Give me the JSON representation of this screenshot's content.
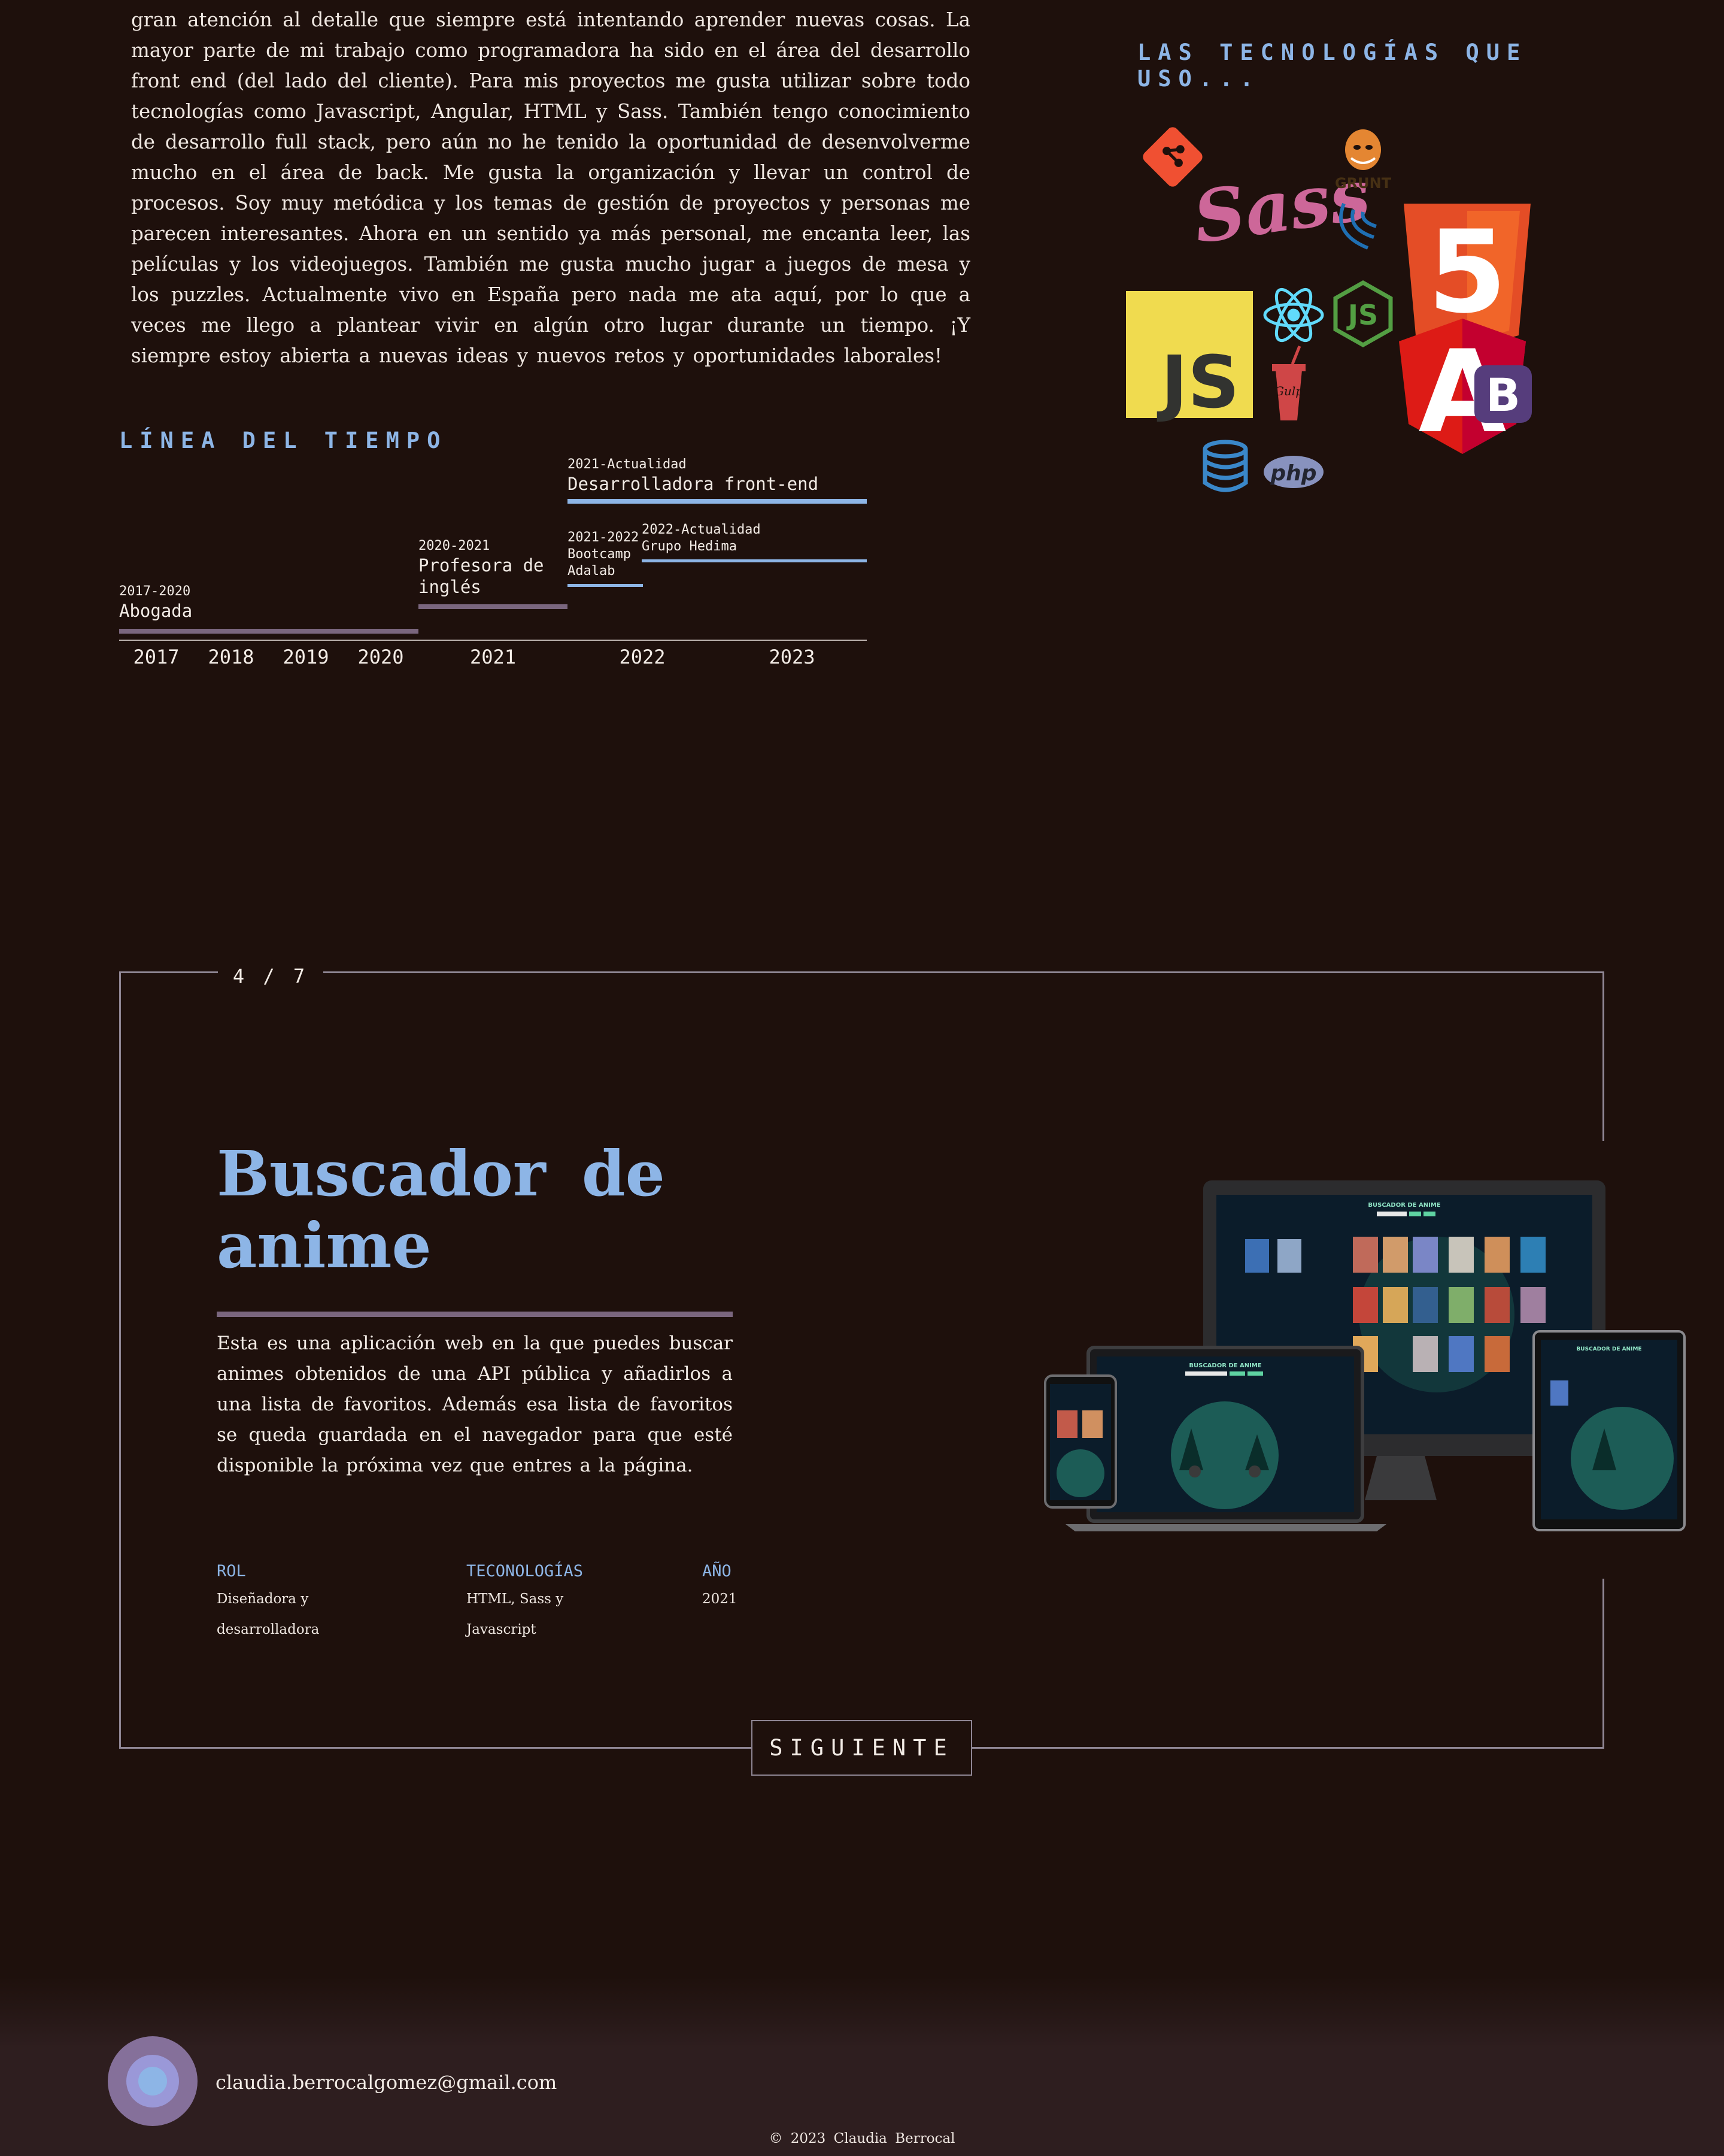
{
  "about": {
    "text": "gran atención al detalle que siempre está intentando aprender nuevas cosas. La mayor parte de mi trabajo como programadora ha sido en el área del desarrollo front end (del lado del cliente). Para mis proyectos me gusta utilizar sobre todo tecnologías como Javascript, Angular, HTML y Sass. También tengo conocimiento de desarrollo full stack, pero aún no he tenido la oportunidad de desenvolverme mucho en el área de back. Me gusta la organización y llevar un control de procesos. Soy muy metódica y los temas de gestión de proyectos y personas me parecen interesantes. Ahora en un sentido ya más personal, me encanta leer, las películas y los videojuegos. También me gusta mucho jugar a juegos de mesa y los puzzles. Actualmente vivo en España pero nada me ata aquí, por lo que a veces me llego a plantear vivir en algún otro lugar durante un tiempo. ¡Y siempre estoy abierta a nuevas ideas y nuevos retos y oportunidades laborales!"
  },
  "tech": {
    "title": "LAS TECNOLOGÍAS QUE USO...",
    "icons": {
      "git": "git-icon",
      "sass": "Sass",
      "grunt": "GRUNT",
      "jquery": "jquery-icon",
      "html5": "5",
      "js": "JS",
      "react": "react-icon",
      "node": "JS",
      "gulp": "Gulp",
      "angular": "A",
      "bootstrap": "B",
      "database": "database-icon",
      "php": "php"
    },
    "colors": {
      "git": "#f05032",
      "sass": "#cd6799",
      "html5": "#e44d26",
      "js": "#f0db4f",
      "react": "#61dafb",
      "node": "#539e43",
      "gulp": "#cf4647",
      "angular": "#dd1b16",
      "bootstrap": "#563d7c",
      "database": "#3a87c9",
      "php": "#8892be"
    }
  },
  "timeline": {
    "title": "LÍNEA DEL TIEMPO",
    "items": [
      {
        "dates": "2021-Actualidad",
        "role": "Desarrolladora front-end"
      },
      {
        "dates": "2020-2021",
        "role": "Profesora de inglés"
      },
      {
        "dates": "2021-2022",
        "role": "Bootcamp Adalab"
      },
      {
        "dates": "2022-Actualidad",
        "role": "Grupo Hedima"
      },
      {
        "dates": "2017-2020",
        "role": "Abogada"
      }
    ],
    "years": [
      "2017",
      "2018",
      "2019",
      "2020",
      "2021",
      "2022",
      "2023"
    ],
    "colors": {
      "primary": "#8db5e6",
      "secondary": "#7a667e"
    }
  },
  "project": {
    "counter": "4 / 7",
    "title": "Buscador de anime",
    "description": "Esta es una aplicación web en la que puedes buscar animes obtenidos de una API pública y añadirlos a una lista de favoritos. Además esa lista de favoritos se queda guardada en el navegador para que esté disponible la próxima vez que entres a la página.",
    "meta": [
      {
        "label": "ROL",
        "value": "Diseñadora y desarrolladora"
      },
      {
        "label": "TECONOLOGÍAS",
        "value": "HTML, Sass y Javascript"
      },
      {
        "label": "AÑO",
        "value": "2021"
      }
    ],
    "mockup_title": "BUSCADOR DE ANIME",
    "next_label": "SIGUIENTE"
  },
  "footer": {
    "email": "claudia.berrocalgomez@gmail.com",
    "copyright": "© 2023 Claudia Berrocal"
  }
}
